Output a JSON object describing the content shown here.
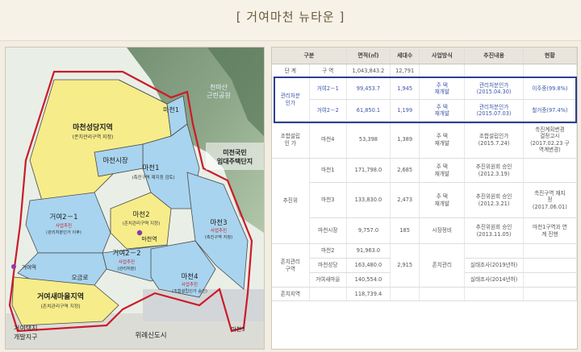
{
  "page": {
    "title": "[ 거여마천 뉴타운 ]"
  },
  "map": {
    "labels": {
      "nat_park": "천마산\n근린공원",
      "machon1_top": "마천1",
      "machon_seongdang": "마천성당지역",
      "machon_seongdang_sub": "(존치관리구역 지정)",
      "machon_market": "마천시장",
      "machon1_mid": "마천1",
      "machon1_mid_sub": "(촉진구역 재지정 검토)",
      "machon_rental": "마천국민\n임대주택단지",
      "geoyeo21": "거여2－1",
      "geoyeo21_sub1": "사업추진",
      "geoyeo21_sub2": "(관리처분인가 이후)",
      "machon2": "마천2",
      "machon2_sub": "(존치관리구역 지정)",
      "machon_station": "마천역",
      "machon3": "마천3",
      "machon3_sub1": "사업추진",
      "machon3_sub2": "(촉진구역 지정)",
      "geoyeo22": "거여2－2",
      "geoyeo22_sub1": "사업추진",
      "geoyeo22_sub2": "(관리처분)",
      "geoyeo_station": "거여역",
      "ogeum": "오금로",
      "machon4": "마천4",
      "machon4_sub1": "사업추진",
      "machon4_sub2": "(조합설립인가 승인)",
      "geoyeo_saemaeul": "거여새마을지역",
      "geoyeo_saemaeul_sub": "(존치관리구역 지정)",
      "geoyeo_dev": "거여택지\n개발지구",
      "wirye": "위례신도시",
      "machon3_bottom": "마천3"
    },
    "colors": {
      "yellow": "#f7ec8a",
      "blue": "#a8d4ef",
      "boundary": "#cc1a2a",
      "line": "#4a4a4a",
      "green_label": "#d8f0ff"
    }
  },
  "table": {
    "headers": [
      "구분",
      "",
      "면적(㎡)",
      "세대수",
      "사업방식",
      "추진내용",
      "현황"
    ],
    "rows": [
      [
        "단 계",
        "구 역",
        "1,043,843.2",
        "12,791",
        "",
        "",
        ""
      ],
      [
        "관리처분\n인가",
        "거여2－1",
        "99,453.7",
        "1,945",
        "주 택\n재개발",
        "관리처분인가\n(2015.04.30)",
        "이주중(99.8%)"
      ],
      [
        "",
        "거여2－2",
        "61,850.1",
        "1,199",
        "주 택\n재개발",
        "관리처분인가\n(2015.07.03)",
        "철거중(97.4%)"
      ],
      [
        "조합설립\n인 가",
        "마천4",
        "53,398",
        "1,389",
        "주 택\n재개발",
        "조합설립인가\n(2015.7.24)",
        "촉진계획변경\n결정고시\n(2017.02.23 구\n역계변경)"
      ],
      [
        "",
        "마천1",
        "171,798.0",
        "2,685",
        "주 택\n재개발",
        "추진위원회 승인\n(2012.3.19)",
        ""
      ],
      [
        "추진위",
        "마천3",
        "133,830.0",
        "2,473",
        "주 택\n재개발",
        "추진위원회 승인\n(2012.3.21)",
        "촉진구역 재지\n정\n(2017.06.01)"
      ],
      [
        "",
        "마천시장",
        "9,757.0",
        "185",
        "시장정비",
        "추진위원회 승인\n(2013.11.05)",
        "마천1구역과 연\n계 진행"
      ],
      [
        "",
        "마천2",
        "91,963.0",
        "",
        "",
        "",
        ""
      ],
      [
        "존치관리\n구역",
        "마천성당",
        "163,480.0",
        "2,915",
        "존치관리",
        "실태조사(2019년하)",
        ""
      ],
      [
        "",
        "거여새마을",
        "140,554.0",
        "",
        "",
        "실태조사(2014년하)",
        ""
      ],
      [
        "존치지역",
        "",
        "118,739.4",
        "",
        "",
        "",
        ""
      ]
    ]
  }
}
